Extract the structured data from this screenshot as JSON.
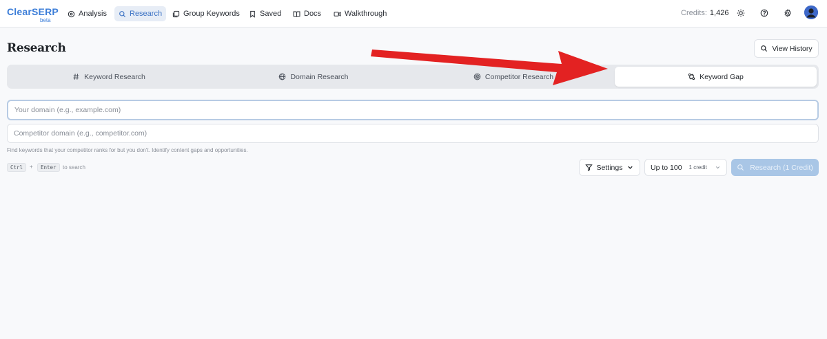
{
  "logo": {
    "name": "ClearSERP",
    "badge": "beta"
  },
  "nav": {
    "items": [
      {
        "label": "Analysis",
        "icon": "analysis-icon"
      },
      {
        "label": "Research",
        "icon": "search-icon",
        "active": true
      },
      {
        "label": "Group Keywords",
        "icon": "group-icon"
      },
      {
        "label": "Saved",
        "icon": "bookmark-icon"
      },
      {
        "label": "Docs",
        "icon": "book-icon"
      },
      {
        "label": "Walkthrough",
        "icon": "video-icon"
      }
    ],
    "credits_label": "Credits:",
    "credits_value": "1,426"
  },
  "page": {
    "title": "Research",
    "history_label": "View History"
  },
  "tabs": [
    {
      "label": "Keyword Research",
      "icon": "hash-icon"
    },
    {
      "label": "Domain Research",
      "icon": "globe-icon"
    },
    {
      "label": "Competitor Research",
      "icon": "target-icon"
    },
    {
      "label": "Keyword Gap",
      "icon": "swap-icon",
      "active": true
    }
  ],
  "form": {
    "domain_placeholder": "Your domain (e.g., example.com)",
    "competitor_placeholder": "Competitor domain (e.g., competitor.com)",
    "hint": "Find keywords that your competitor ranks for but you don't. Identify content gaps and opportunities.",
    "shortcut_key1": "Ctrl",
    "shortcut_plus": "+",
    "shortcut_key2": "Enter",
    "shortcut_text": "to search"
  },
  "actions": {
    "settings_label": "Settings",
    "limit_label": "Up to 100",
    "limit_sub": "1 credit",
    "research_label": "Research (1 Credit)"
  },
  "colors": {
    "accent": "#3b7dd8",
    "arrow": "#e32222",
    "research_button": "#a9c6e6"
  }
}
